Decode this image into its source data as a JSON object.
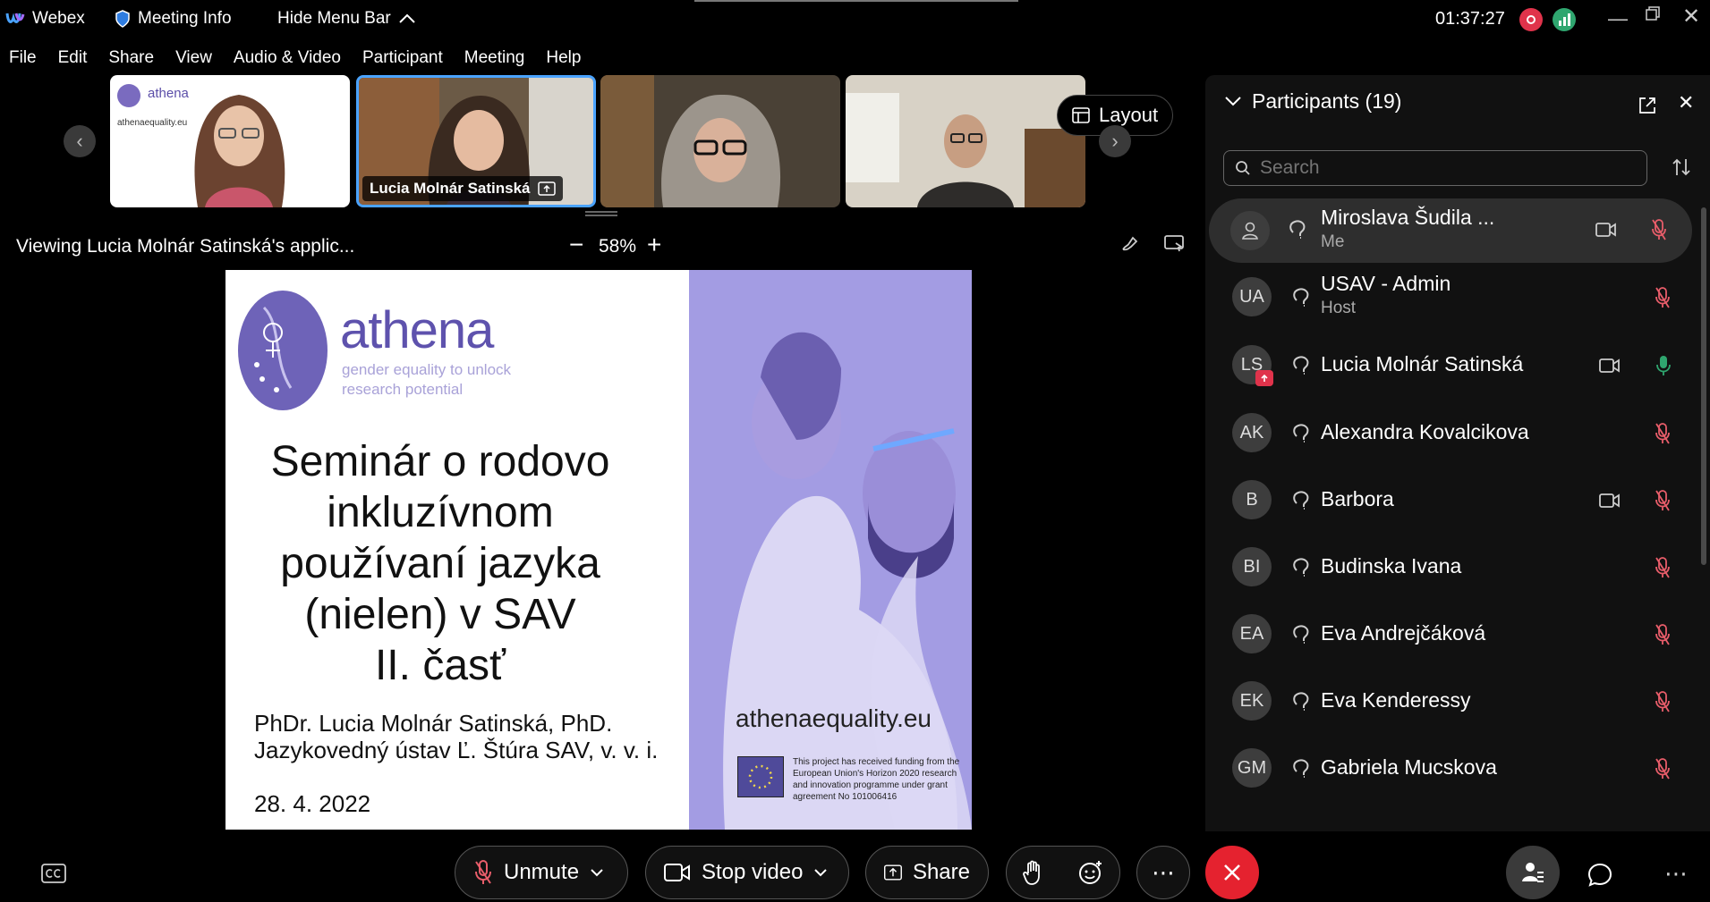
{
  "titlebar": {
    "app_name": "Webex",
    "meeting_info": "Meeting Info",
    "hide_menu": "Hide Menu Bar",
    "clock": "01:37:27",
    "colors": {
      "record": "#e0334b",
      "stats": "#2fa66f"
    }
  },
  "menu": [
    "File",
    "Edit",
    "Share",
    "View",
    "Audio & Video",
    "Participant",
    "Meeting",
    "Help"
  ],
  "thumbnails": {
    "active_label": "Lucia Molnár Satinská",
    "layout_label": "Layout",
    "mini_slide_title": "athena",
    "mini_slide_url": "athenaequality.eu"
  },
  "sharing": {
    "status": "Viewing Lucia Molnár Satinská's applic...",
    "zoom": "58%"
  },
  "slide": {
    "logo_title": "athena",
    "logo_tagline_1": "gender equality to unlock",
    "logo_tagline_2": "research potential",
    "title_lines": [
      "Seminár o rodovo",
      "inkluzívnom",
      "používaní jazyka",
      "(nielen) v SAV",
      "II. časť"
    ],
    "author": "PhDr. Lucia Molnár Satinská, PhD.",
    "institute": "Jazykovedný ústav Ľ. Štúra SAV, v. v. i.",
    "date": "28. 4. 2022",
    "url": "athenaequality.eu",
    "funding_1": "This project has received funding from the",
    "funding_2": "European Union's Horizon 2020 research",
    "funding_3": "and innovation programme under grant",
    "funding_4": "agreement No 101006416"
  },
  "panel": {
    "title": "Participants (19)",
    "search_placeholder": "Search",
    "participants": [
      {
        "initials": "",
        "name": "Miroslava Šudila ...",
        "sub": "Me",
        "video": true,
        "mic": "muted"
      },
      {
        "initials": "UA",
        "name": "USAV - Admin",
        "sub": "Host",
        "video": false,
        "mic": "muted"
      },
      {
        "initials": "LS",
        "name": "Lucia Molnár Satinská",
        "sub": "",
        "video": true,
        "mic": "active"
      },
      {
        "initials": "AK",
        "name": "Alexandra Kovalcikova",
        "sub": "",
        "video": false,
        "mic": "muted"
      },
      {
        "initials": "B",
        "name": "Barbora",
        "sub": "",
        "video": true,
        "mic": "muted"
      },
      {
        "initials": "BI",
        "name": "Budinska Ivana",
        "sub": "",
        "video": false,
        "mic": "muted"
      },
      {
        "initials": "EA",
        "name": "Eva Andrejčáková",
        "sub": "",
        "video": false,
        "mic": "muted"
      },
      {
        "initials": "EK",
        "name": "Eva Kenderessy",
        "sub": "",
        "video": false,
        "mic": "muted"
      },
      {
        "initials": "GM",
        "name": "Gabriela Mucskova",
        "sub": "",
        "video": false,
        "mic": "muted"
      }
    ]
  },
  "toolbar": {
    "unmute": "Unmute",
    "stop_video": "Stop video",
    "share": "Share",
    "colors": {
      "end": "#e5222f",
      "muted": "#e85d6a",
      "active_mic": "#2fa66f"
    }
  }
}
